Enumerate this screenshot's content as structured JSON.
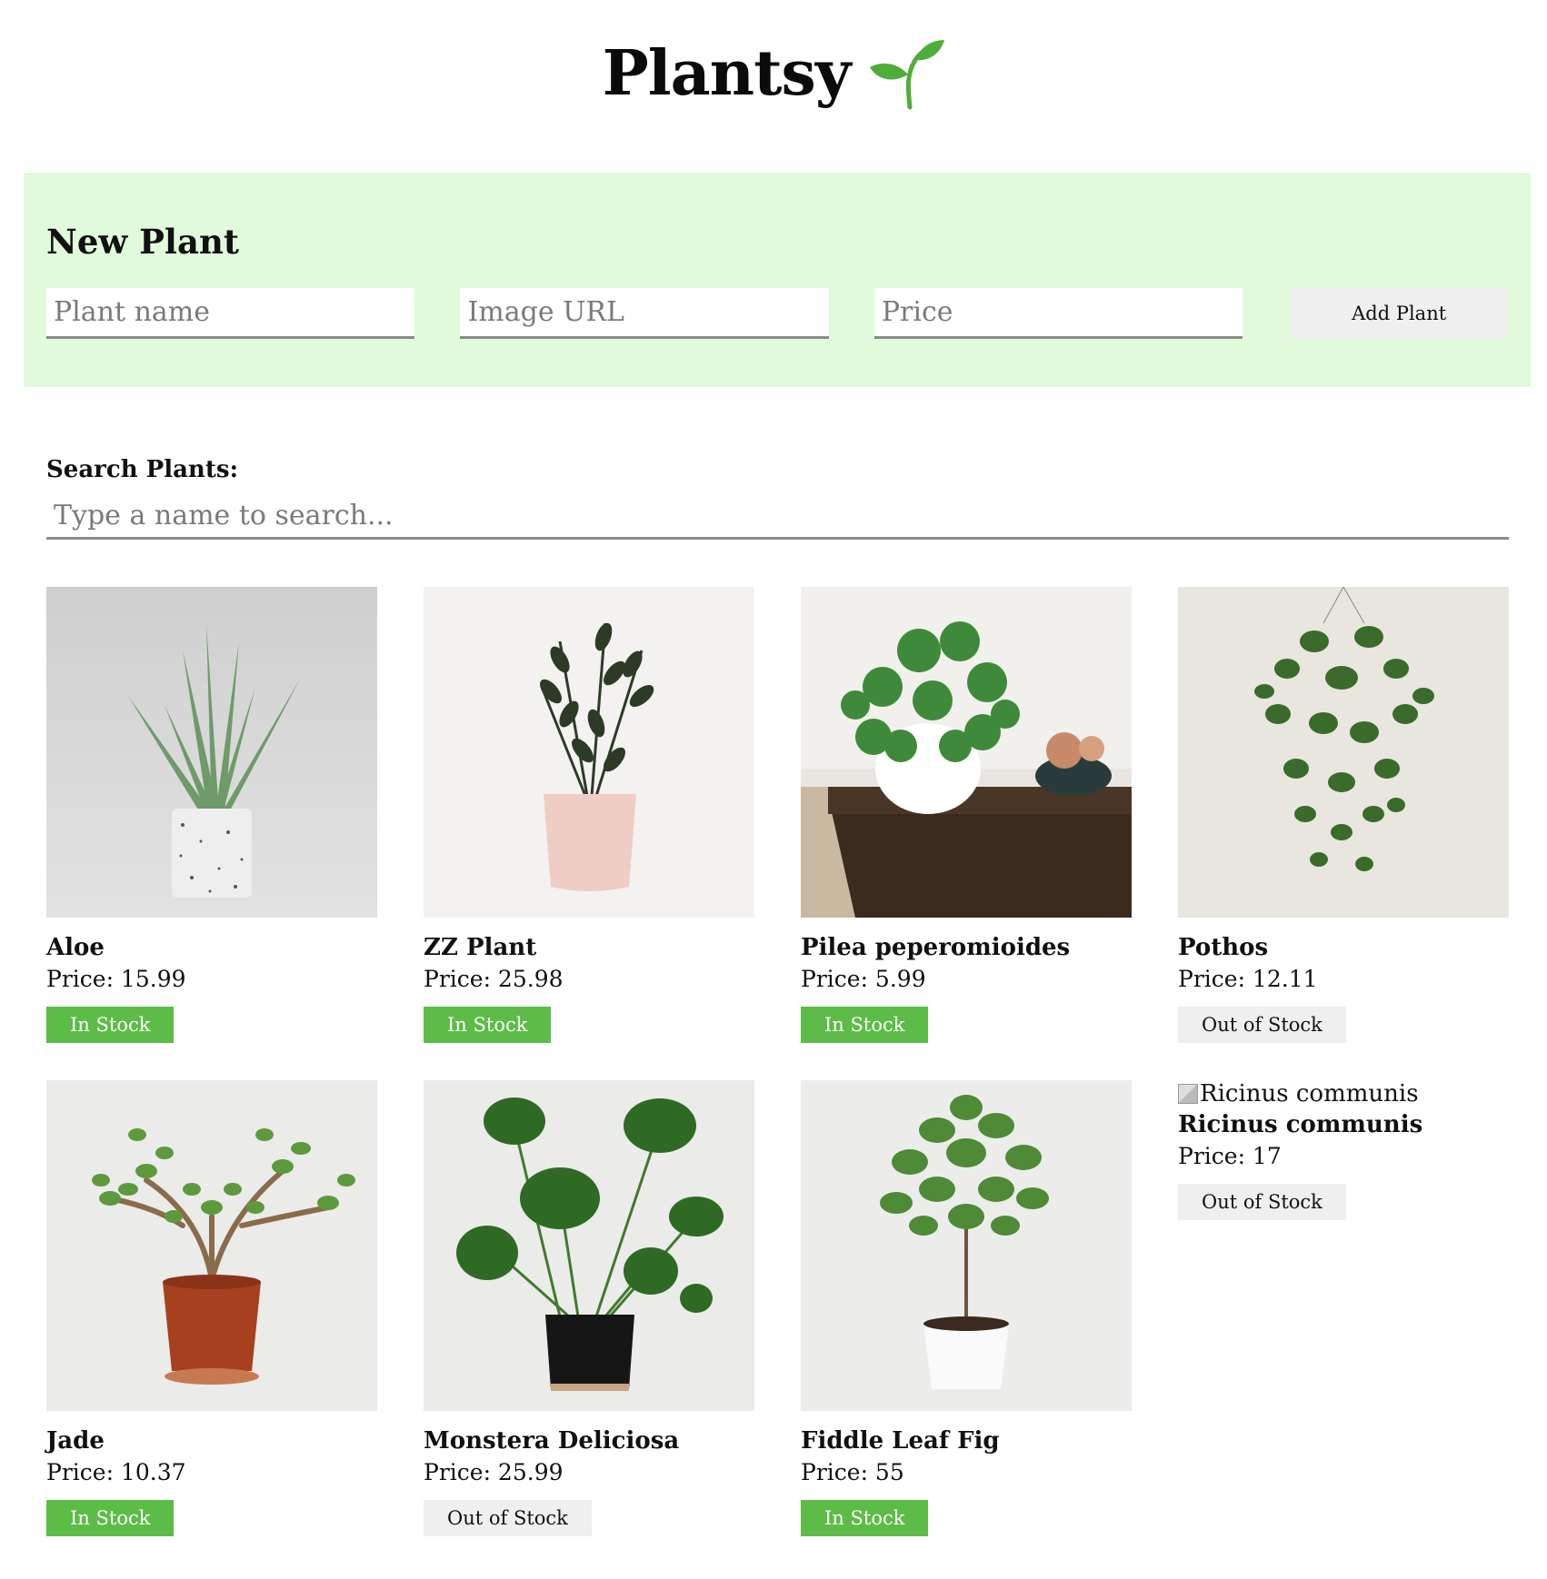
{
  "app": {
    "title": "Plantsy",
    "logo_icon": "sprout-icon"
  },
  "new_plant": {
    "heading": "New Plant",
    "name_placeholder": "Plant name",
    "image_placeholder": "Image URL",
    "price_placeholder": "Price",
    "submit_label": "Add Plant"
  },
  "search": {
    "label": "Search Plants:",
    "placeholder": "Type a name to search..."
  },
  "colors": {
    "in_stock": "#5cbc47",
    "out_stock": "#efefef",
    "form_bg": "#e1fadb"
  },
  "plants": [
    {
      "name": "Aloe",
      "price": "Price: 15.99",
      "stock": "In Stock"
    },
    {
      "name": "ZZ Plant",
      "price": "Price: 25.98",
      "stock": "In Stock"
    },
    {
      "name": "Pilea peperomioides",
      "price": "Price: 5.99",
      "stock": "In Stock"
    },
    {
      "name": "Pothos",
      "price": "Price: 12.11",
      "stock": "Out of Stock"
    },
    {
      "name": "Jade",
      "price": "Price: 10.37",
      "stock": "In Stock"
    },
    {
      "name": "Monstera Deliciosa",
      "price": "Price: 25.99",
      "stock": "Out of Stock"
    },
    {
      "name": "Fiddle Leaf Fig",
      "price": "Price: 55",
      "stock": "In Stock"
    },
    {
      "name": "Ricinus communis",
      "price": "Price: 17",
      "stock": "Out of Stock",
      "image_alt": "Ricinus communis"
    }
  ]
}
